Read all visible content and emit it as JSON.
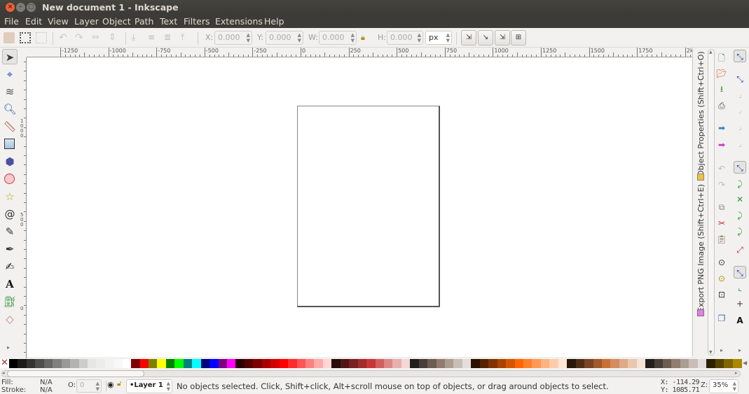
{
  "window": {
    "title": "New document 1 - Inkscape"
  },
  "menu": [
    "File",
    "Edit",
    "View",
    "Layer",
    "Object",
    "Path",
    "Text",
    "Filters",
    "Extensions",
    "Help"
  ],
  "toolbar": {
    "icons": [
      "select-all-icon",
      "select-all-layers-icon",
      "deselect-icon",
      "rotate-ccw-icon",
      "rotate-cw-icon",
      "flip-horizontal-icon",
      "flip-vertical-icon",
      "lower-to-bottom-icon",
      "lower-icon",
      "raise-icon",
      "raise-to-top-icon"
    ],
    "x_label": "X:",
    "x_value": "0.000",
    "y_label": "Y:",
    "y_value": "0.000",
    "w_label": "W:",
    "w_value": "0.000",
    "h_label": "H:",
    "h_value": "0.000",
    "unit": "px"
  },
  "ruler": {
    "h_labels": [
      "-1250",
      "-1000",
      "-750",
      "-500",
      "-250",
      "0",
      "250",
      "500",
      "750",
      "1000",
      "1250",
      "1500",
      "1750",
      "2k"
    ],
    "v_labels": [
      "1000",
      "500",
      "0"
    ]
  },
  "tools": [
    "selector",
    "node",
    "tweak",
    "zoom",
    "measure",
    "rectangle",
    "3d-box",
    "ellipse",
    "star",
    "spiral",
    "pencil",
    "pen",
    "calligraphy",
    "text",
    "spray",
    "eraser"
  ],
  "dock": {
    "tabs": [
      "Object Properties (Shift+Ctrl+O)",
      "Export PNG Image (Shift+Ctrl+E)"
    ]
  },
  "palette": [
    "#000000",
    "#1a1a1a",
    "#333333",
    "#4d4d4d",
    "#666666",
    "#808080",
    "#999999",
    "#b3b3b3",
    "#cccccc",
    "#e6e6e6",
    "#ececec",
    "#f2f2f2",
    "#f8f8f8",
    "#ffffff",
    "#800000",
    "#ff0000",
    "#808000",
    "#ffff00",
    "#008000",
    "#00ff00",
    "#008080",
    "#00ffff",
    "#000080",
    "#0000ff",
    "#800080",
    "#ff00ff",
    "#2b0000",
    "#550000",
    "#800000",
    "#aa0000",
    "#d40000",
    "#ff0000",
    "#ff2a2a",
    "#ff5555",
    "#ff8080",
    "#ffaaaa",
    "#ffd5d5",
    "#280b0b",
    "#501616",
    "#782121",
    "#a02c2c",
    "#c83737",
    "#d35f5f",
    "#de8787",
    "#e9afaf",
    "#f4d7d7",
    "#241f1c",
    "#483e37",
    "#6c5d53",
    "#917c6f",
    "#ac9d93",
    "#c8beb7",
    "#e3dedb",
    "#2b1100",
    "#552200",
    "#803300",
    "#aa4400",
    "#d45500",
    "#ff6600",
    "#ff7f2a",
    "#ff9955",
    "#ffb380",
    "#ffccaa",
    "#ffe6d5",
    "#28170b",
    "#502d16",
    "#784421",
    "#a05a2c",
    "#c87137",
    "#d38d5f",
    "#deaa87",
    "#e9c6af",
    "#f4e3d7",
    "#241f1c",
    "#483e37",
    "#6c5d53",
    "#917c6f",
    "#ac9d93",
    "#c8beb7",
    "#e3dedb",
    "#2b2200",
    "#554400",
    "#806600",
    "#aa8800"
  ],
  "status": {
    "fill_label": "Fill:",
    "fill_value": "N/A",
    "stroke_label": "Stroke:",
    "stroke_value": "N/A",
    "opacity_label": "O:",
    "opacity_value": "0",
    "layer": "•Layer 1",
    "message": "No objects selected. Click, Shift+click, Alt+scroll mouse on top of objects, or drag around objects to select.",
    "x_coord": "X: -114.29",
    "y_coord": "Y: 1085.71",
    "zoom_label": "Z:",
    "zoom_value": "35%"
  }
}
